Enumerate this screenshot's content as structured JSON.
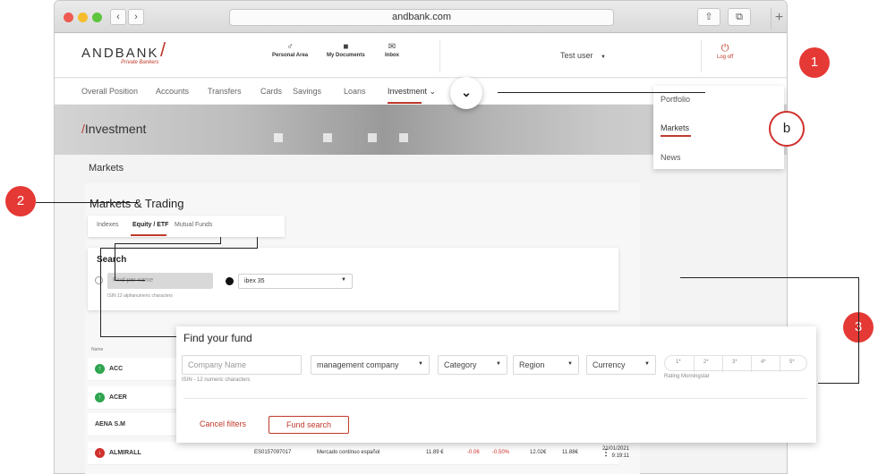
{
  "browser": {
    "url": "andbank.com"
  },
  "header": {
    "logo_text": "ANDBANK",
    "logo_sub": "Private Bankers",
    "logo_slash": "/",
    "icons": [
      {
        "label": "Personal Area",
        "glyph": "♂"
      },
      {
        "label": "My Documents",
        "glyph": "■"
      },
      {
        "label": "Inbox",
        "glyph": "✉"
      }
    ],
    "user": "Test user",
    "logoff": "Log off"
  },
  "nav": {
    "items": [
      "Overall Position",
      "Accounts",
      "Transfers",
      "Cards",
      "Savings",
      "Loans",
      "Investment"
    ],
    "active_caret": "⌄"
  },
  "banner": {
    "slash": "/",
    "title": "Investment"
  },
  "breadcrumb": "Markets",
  "markets": {
    "title": "Markets & Trading",
    "tabs": [
      "Indexes",
      "Equity / ETF",
      "Mutual Funds"
    ]
  },
  "search": {
    "title": "Search",
    "placeholder": "Find per name",
    "hint": "ISIN 12 alphanumeric characters",
    "index_select": "ibex 35"
  },
  "table": {
    "name_header": "Name",
    "rows": [
      {
        "name": "ACC",
        "dir": "up"
      },
      {
        "name": "ACER",
        "dir": "up"
      },
      {
        "name": "AENA S.M",
        "dir": "none"
      },
      {
        "name": "ALMIRALL",
        "dir": "down",
        "isin": "ES0157097017",
        "market": "Mercado continuo español",
        "last": "11.89 €",
        "chg": "-0.06",
        "pct": "-0.50%",
        "high": "12.02€",
        "low": "11.88€",
        "date": "21/01/2021",
        "time": "9:19:11"
      }
    ]
  },
  "menu": {
    "items": [
      "Portfolio",
      "Markets",
      "News"
    ]
  },
  "chevron": "⌄",
  "fund": {
    "title": "Find your fund",
    "company_placeholder": "Company Name",
    "company_hint": "ISIN - 12 numeric characters",
    "selects": [
      "management company",
      "Category",
      "Region",
      "Currency"
    ],
    "ratings": [
      "1*",
      "2*",
      "3*",
      "4*",
      "5*"
    ],
    "rating_label": "Rating Morningstar",
    "cancel": "Cancel filters",
    "search_btn": "Fund search"
  },
  "annotations": {
    "one": "1",
    "two": "2",
    "three": "3",
    "b": "b"
  }
}
